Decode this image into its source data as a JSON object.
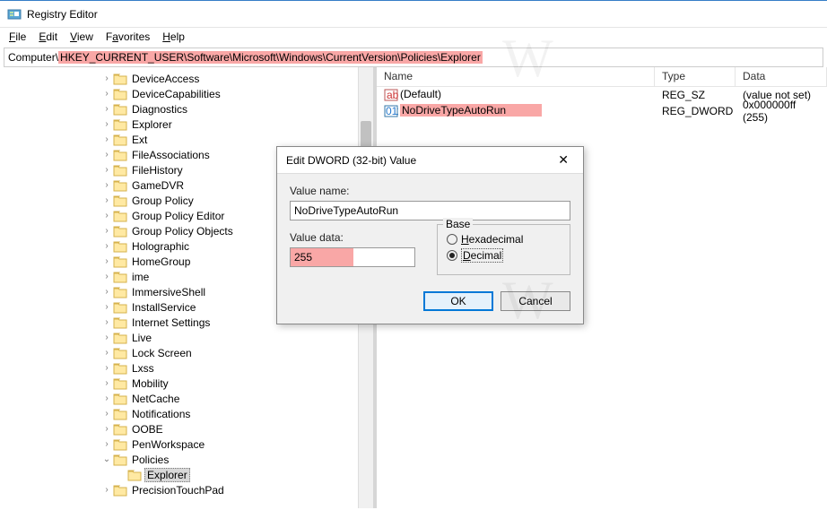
{
  "window": {
    "title": "Registry Editor"
  },
  "menu": {
    "file": "File",
    "edit": "Edit",
    "view": "View",
    "favorites": "Favorites",
    "help": "Help"
  },
  "address": {
    "prefix": "Computer\\",
    "path": "HKEY_CURRENT_USER\\Software\\Microsoft\\Windows\\CurrentVersion\\Policies\\Explorer"
  },
  "tree": {
    "items": [
      "DeviceAccess",
      "DeviceCapabilities",
      "Diagnostics",
      "Explorer",
      "Ext",
      "FileAssociations",
      "FileHistory",
      "GameDVR",
      "Group Policy",
      "Group Policy Editor",
      "Group Policy Objects",
      "Holographic",
      "HomeGroup",
      "ime",
      "ImmersiveShell",
      "InstallService",
      "Internet Settings",
      "Live",
      "Lock Screen",
      "Lxss",
      "Mobility",
      "NetCache",
      "Notifications",
      "OOBE",
      "PenWorkspace"
    ],
    "policies_label": "Policies",
    "selected": "Explorer",
    "last_cut": "PrecisionTouchPad"
  },
  "list": {
    "headers": {
      "name": "Name",
      "type": "Type",
      "data": "Data"
    },
    "rows": [
      {
        "name": "(Default)",
        "type": "REG_SZ",
        "data": "(value not set)",
        "icon": "string"
      },
      {
        "name": "NoDriveTypeAutoRun",
        "type": "REG_DWORD",
        "data": "0x000000ff (255)",
        "icon": "binary",
        "hl": true
      }
    ]
  },
  "dialog": {
    "title": "Edit DWORD (32-bit) Value",
    "value_name_label": "Value name:",
    "value_name": "NoDriveTypeAutoRun",
    "value_data_label": "Value data:",
    "value_data": "255",
    "base_legend": "Base",
    "hex": "Hexadecimal",
    "dec": "Decimal",
    "selected_base": "Decimal",
    "ok": "OK",
    "cancel": "Cancel"
  }
}
